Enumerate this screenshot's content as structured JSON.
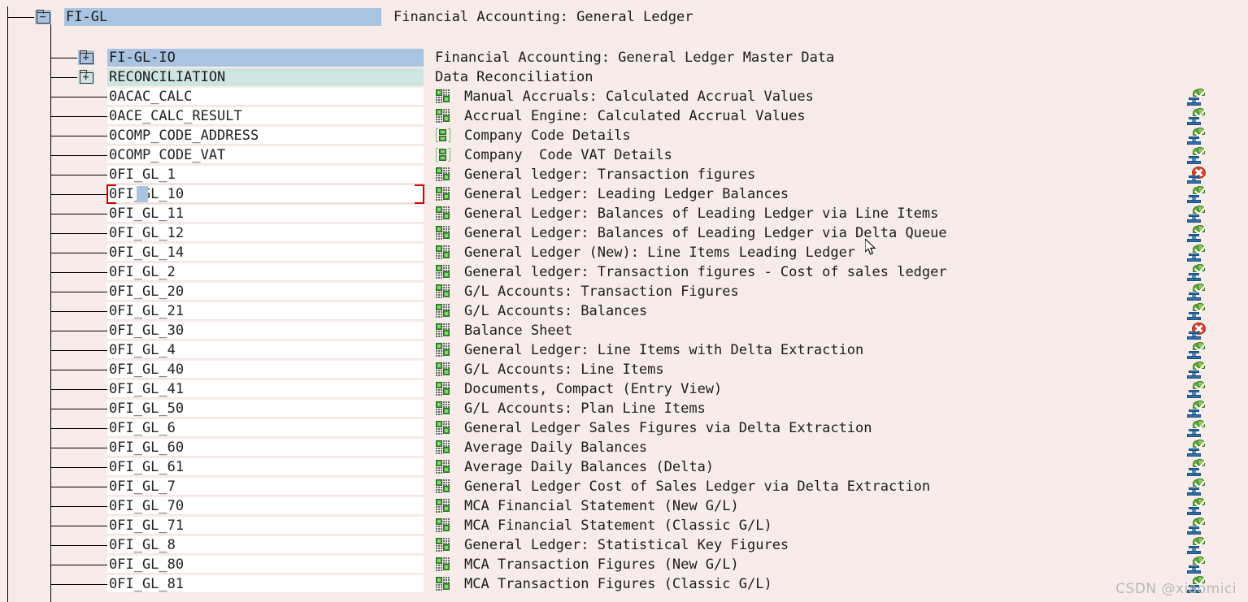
{
  "app": {
    "watermark": "CSDN @xiaomici"
  },
  "tree": {
    "root": {
      "name": "FI-GL",
      "description": "Financial Accounting: General Ledger",
      "folder_icon": "folder-open-icon",
      "folder_sign": "−",
      "selected": true
    },
    "folders": [
      {
        "name": "FI-GL-IO",
        "description": "Financial Accounting: General Ledger Master Data",
        "folder_icon": "folder-closed-icon",
        "folder_sign": "+",
        "highlight": "blue"
      },
      {
        "name": "RECONCILIATION",
        "description": "Data Reconciliation",
        "folder_icon": "folder-closed-icon",
        "folder_sign": "+",
        "highlight": "teal"
      }
    ],
    "datasources": [
      {
        "name": "0ACAC_CALC",
        "description": "Manual Accruals: Calculated Accrual Values",
        "icon": "transactional-datasource-icon",
        "status": "transport-ok-icon"
      },
      {
        "name": "0ACE_CALC_RESULT",
        "description": "Accrual Engine: Calculated Accrual Values",
        "icon": "transactional-datasource-icon",
        "status": "transport-ok-icon"
      },
      {
        "name": "0COMP_CODE_ADDRESS",
        "description": "Company Code Details",
        "icon": "masterdata-datasource-icon",
        "status": "transport-ok-icon"
      },
      {
        "name": "0COMP_CODE_VAT",
        "description": "Company  Code VAT Details",
        "icon": "masterdata-datasource-icon",
        "status": "transport-ok-icon"
      },
      {
        "name": "0FI_GL_1",
        "description": "General ledger: Transaction figures",
        "icon": "transactional-datasource-icon",
        "status": "transport-error-icon"
      },
      {
        "name": "0FI_GL_10",
        "description": "General Ledger: Leading Ledger Balances",
        "icon": "transactional-datasource-icon",
        "status": "transport-ok-icon",
        "focused": true
      },
      {
        "name": "0FI_GL_11",
        "description": "General Ledger: Balances of Leading Ledger via Line Items",
        "icon": "transactional-datasource-icon",
        "status": "transport-ok-icon"
      },
      {
        "name": "0FI_GL_12",
        "description": "General Ledger: Balances of Leading Ledger via Delta Queue",
        "icon": "transactional-datasource-icon",
        "status": "transport-ok-icon"
      },
      {
        "name": "0FI_GL_14",
        "description": "General Ledger (New): Line Items Leading Ledger",
        "icon": "transactional-datasource-icon",
        "status": "transport-ok-icon"
      },
      {
        "name": "0FI_GL_2",
        "description": "General ledger: Transaction figures - Cost of sales ledger",
        "icon": "transactional-datasource-icon",
        "status": "transport-ok-icon"
      },
      {
        "name": "0FI_GL_20",
        "description": "G/L Accounts: Transaction Figures",
        "icon": "transactional-datasource-icon",
        "status": "transport-ok-icon"
      },
      {
        "name": "0FI_GL_21",
        "description": "G/L Accounts: Balances",
        "icon": "transactional-datasource-icon",
        "status": "transport-ok-icon"
      },
      {
        "name": "0FI_GL_30",
        "description": "Balance Sheet",
        "icon": "transactional-datasource-icon",
        "status": "transport-error-icon"
      },
      {
        "name": "0FI_GL_4",
        "description": "General Ledger: Line Items with Delta Extraction",
        "icon": "transactional-datasource-icon",
        "status": "transport-ok-icon"
      },
      {
        "name": "0FI_GL_40",
        "description": "G/L Accounts: Line Items",
        "icon": "transactional-datasource-icon",
        "status": "transport-ok-icon"
      },
      {
        "name": "0FI_GL_41",
        "description": "Documents, Compact (Entry View)",
        "icon": "transactional-datasource-icon",
        "status": "transport-ok-icon"
      },
      {
        "name": "0FI_GL_50",
        "description": "G/L Accounts: Plan Line Items",
        "icon": "transactional-datasource-icon",
        "status": "transport-ok-icon"
      },
      {
        "name": "0FI_GL_6",
        "description": "General Ledger Sales Figures via Delta Extraction",
        "icon": "transactional-datasource-icon",
        "status": "transport-ok-icon"
      },
      {
        "name": "0FI_GL_60",
        "description": "Average Daily Balances",
        "icon": "transactional-datasource-icon",
        "status": "transport-ok-icon"
      },
      {
        "name": "0FI_GL_61",
        "description": "Average Daily Balances (Delta)",
        "icon": "transactional-datasource-icon",
        "status": "transport-ok-icon"
      },
      {
        "name": "0FI_GL_7",
        "description": "General Ledger Cost of Sales Ledger via Delta Extraction",
        "icon": "transactional-datasource-icon",
        "status": "transport-ok-icon"
      },
      {
        "name": "0FI_GL_70",
        "description": "MCA Financial Statement (New G/L)",
        "icon": "transactional-datasource-icon",
        "status": "transport-ok-icon"
      },
      {
        "name": "0FI_GL_71",
        "description": "MCA Financial Statement (Classic G/L)",
        "icon": "transactional-datasource-icon",
        "status": "transport-ok-icon"
      },
      {
        "name": "0FI_GL_8",
        "description": "General Ledger: Statistical Key Figures",
        "icon": "transactional-datasource-icon",
        "status": "transport-ok-icon"
      },
      {
        "name": "0FI_GL_80",
        "description": "MCA Transaction Figures (New G/L)",
        "icon": "transactional-datasource-icon",
        "status": "transport-ok-icon"
      },
      {
        "name": "0FI_GL_81",
        "description": "MCA Transaction Figures (Classic G/L)",
        "icon": "transactional-datasource-icon",
        "status": "transport-ok-icon"
      }
    ]
  },
  "colors": {
    "background": "#f7ece9",
    "row_background": "#ffffff",
    "selection_blue": "#a8c4e0",
    "selection_teal": "#cfe5e2",
    "focus_red": "#d40000",
    "icon_green": "#3f9b35",
    "icon_blue": "#2f6fa8",
    "error_red": "#d8442a"
  }
}
